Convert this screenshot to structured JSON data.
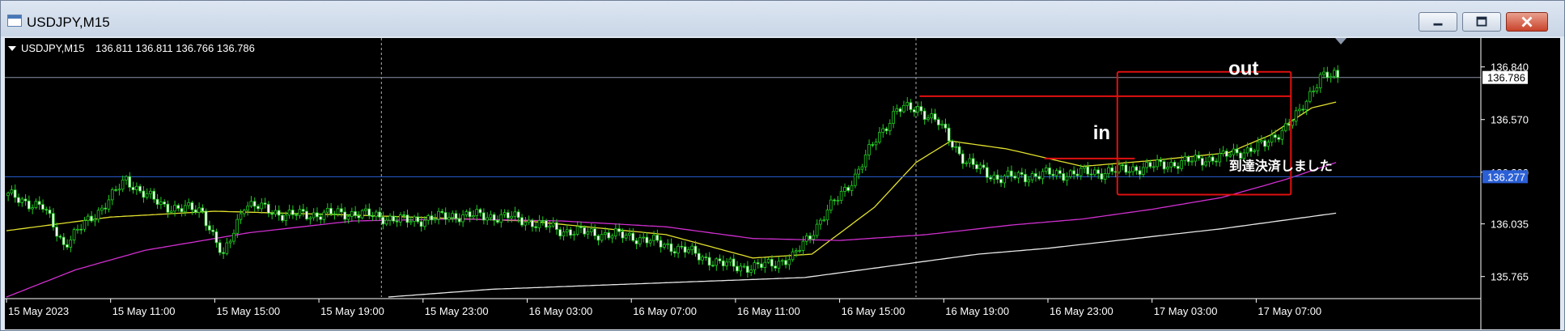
{
  "window": {
    "title": "USDJPY,M15"
  },
  "chart_data": {
    "type": "candlestick",
    "title": "USDJPY,M15",
    "ohlc_label": "136.811 136.811 136.766 136.786",
    "current_price": 136.786,
    "current_price_label": "136.786",
    "ylim": [
      135.66,
      136.93
    ],
    "yticks": [
      135.765,
      136.035,
      136.3,
      136.57,
      136.84
    ],
    "ytick_labels": [
      "135.765",
      "136.035",
      "136.300",
      "136.570",
      "136.840"
    ],
    "xtick_labels": [
      "15 May 2023",
      "15 May 11:00",
      "15 May 15:00",
      "15 May 19:00",
      "15 May 23:00",
      "16 May 03:00",
      "16 May 07:00",
      "16 May 11:00",
      "16 May 15:00",
      "16 May 19:00",
      "16 May 23:00",
      "17 May 03:00",
      "17 May 07:00"
    ],
    "grid": false,
    "period_separators": [
      "16 May",
      "17 May"
    ],
    "hline": {
      "price": 136.277,
      "label": "136.277",
      "color": "#2a5fd6"
    },
    "close_anchors": [
      [
        0,
        136.18
      ],
      [
        10,
        136.12
      ],
      [
        16,
        135.93
      ],
      [
        26,
        136.1
      ],
      [
        34,
        136.26
      ],
      [
        44,
        136.13
      ],
      [
        56,
        136.1
      ],
      [
        62,
        135.86
      ],
      [
        68,
        136.14
      ],
      [
        80,
        136.08
      ],
      [
        100,
        136.09
      ],
      [
        115,
        136.05
      ],
      [
        130,
        136.08
      ],
      [
        145,
        136.07
      ],
      [
        160,
        136.0
      ],
      [
        180,
        135.97
      ],
      [
        195,
        135.9
      ],
      [
        205,
        135.83
      ],
      [
        215,
        135.81
      ],
      [
        226,
        135.86
      ],
      [
        236,
        136.1
      ],
      [
        244,
        136.28
      ],
      [
        250,
        136.47
      ],
      [
        256,
        136.62
      ],
      [
        262,
        136.63
      ],
      [
        268,
        136.55
      ],
      [
        276,
        136.35
      ],
      [
        285,
        136.27
      ],
      [
        300,
        136.29
      ],
      [
        315,
        136.3
      ],
      [
        325,
        136.32
      ],
      [
        338,
        136.35
      ],
      [
        350,
        136.38
      ],
      [
        362,
        136.44
      ],
      [
        372,
        136.6
      ],
      [
        378,
        136.8
      ],
      [
        383,
        136.786
      ]
    ],
    "series": [
      {
        "name": "",
        "color": "#e2e12e",
        "anchors": [
          [
            0,
            136.0
          ],
          [
            30,
            136.07
          ],
          [
            60,
            136.1
          ],
          [
            100,
            136.08
          ],
          [
            150,
            136.05
          ],
          [
            190,
            135.98
          ],
          [
            215,
            135.86
          ],
          [
            232,
            135.88
          ],
          [
            250,
            136.12
          ],
          [
            262,
            136.35
          ],
          [
            272,
            136.46
          ],
          [
            288,
            136.42
          ],
          [
            310,
            136.33
          ],
          [
            330,
            136.36
          ],
          [
            352,
            136.4
          ],
          [
            364,
            136.49
          ],
          [
            376,
            136.63
          ],
          [
            383,
            136.66
          ]
        ]
      },
      {
        "name": "",
        "color": "#d02fd0",
        "anchors": [
          [
            0,
            135.66
          ],
          [
            20,
            135.8
          ],
          [
            40,
            135.9
          ],
          [
            70,
            135.99
          ],
          [
            100,
            136.05
          ],
          [
            130,
            136.06
          ],
          [
            160,
            136.05
          ],
          [
            190,
            136.02
          ],
          [
            215,
            135.96
          ],
          [
            240,
            135.95
          ],
          [
            265,
            135.98
          ],
          [
            290,
            136.03
          ],
          [
            310,
            136.06
          ],
          [
            330,
            136.11
          ],
          [
            350,
            136.17
          ],
          [
            368,
            136.26
          ],
          [
            383,
            136.35
          ]
        ]
      },
      {
        "name": "",
        "color": "#e8e8e8",
        "anchors": [
          [
            110,
            135.66
          ],
          [
            140,
            135.7
          ],
          [
            170,
            135.72
          ],
          [
            200,
            135.74
          ],
          [
            230,
            135.76
          ],
          [
            255,
            135.82
          ],
          [
            280,
            135.88
          ],
          [
            300,
            135.91
          ],
          [
            320,
            135.95
          ],
          [
            350,
            136.01
          ],
          [
            383,
            136.09
          ]
        ]
      }
    ],
    "annotations": {
      "labels": [
        {
          "text": "out",
          "price": 136.8,
          "bar": 352,
          "color": "#ffffff"
        },
        {
          "text": "in",
          "price": 136.47,
          "bar": 313,
          "color": "#ffffff"
        },
        {
          "text": "到達決済しました",
          "price": 136.31,
          "bar": 382,
          "color": "#ffffff"
        }
      ],
      "lines": [
        {
          "color": "#e01010",
          "price": 136.69,
          "bar_from": 263,
          "bar_to": 370
        },
        {
          "color": "#e01010",
          "price": 136.37,
          "bar_from": 299,
          "bar_to": 325
        }
      ],
      "rect": {
        "color": "#e01010",
        "price_top": 136.815,
        "price_bottom": 136.185,
        "bar_from": 320,
        "bar_to": 370
      }
    }
  }
}
